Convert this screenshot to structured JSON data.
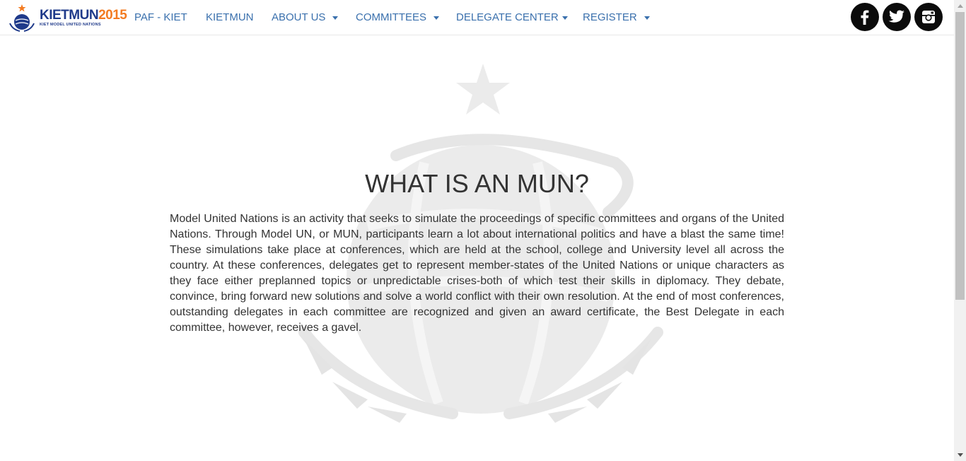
{
  "brand": {
    "name_part1": "KIETMUN",
    "name_part2": "2015",
    "tagline": "KIET MODEL UNITED NATIONS"
  },
  "nav": {
    "items": [
      {
        "label": "PAF - KIET",
        "dropdown": false
      },
      {
        "label": "KIETMUN",
        "dropdown": false
      },
      {
        "label": "ABOUT US",
        "dropdown": true
      },
      {
        "label": "COMMITTEES",
        "dropdown": true
      },
      {
        "label": "DELEGATE CENTER",
        "dropdown": true
      },
      {
        "label": "REGISTER",
        "dropdown": true
      }
    ]
  },
  "social": [
    {
      "name": "facebook",
      "icon": "facebook-icon"
    },
    {
      "name": "twitter",
      "icon": "twitter-icon"
    },
    {
      "name": "instagram",
      "icon": "instagram-icon"
    }
  ],
  "main": {
    "title": "WHAT IS AN MUN?",
    "body": "Model United Nations is an activity that seeks to simulate the proceedings of specific committees and organs of the United Nations. Through Model UN, or MUN, participants learn a lot about international politics and have a blast the same time! These simulations take place at conferences, which are held at the school, college and University level all across the country. At these conferences, delegates get to represent member-states of the United Nations or unique characters as they face either preplanned topics or unpredictable crises-both of which test their skills in diplomacy. They debate, convince, bring forward new solutions and solve a world conflict with their own resolution. At the end of most conferences, outstanding delegates in each committee are recognized and given an award certificate, the Best Delegate in each committee, however, receives a gavel."
  },
  "colors": {
    "nav_link": "#3a70ad",
    "brand_blue": "#1f3a8a",
    "brand_orange": "#f37b21",
    "text": "#333333",
    "watermark": "#e9e9e9"
  }
}
